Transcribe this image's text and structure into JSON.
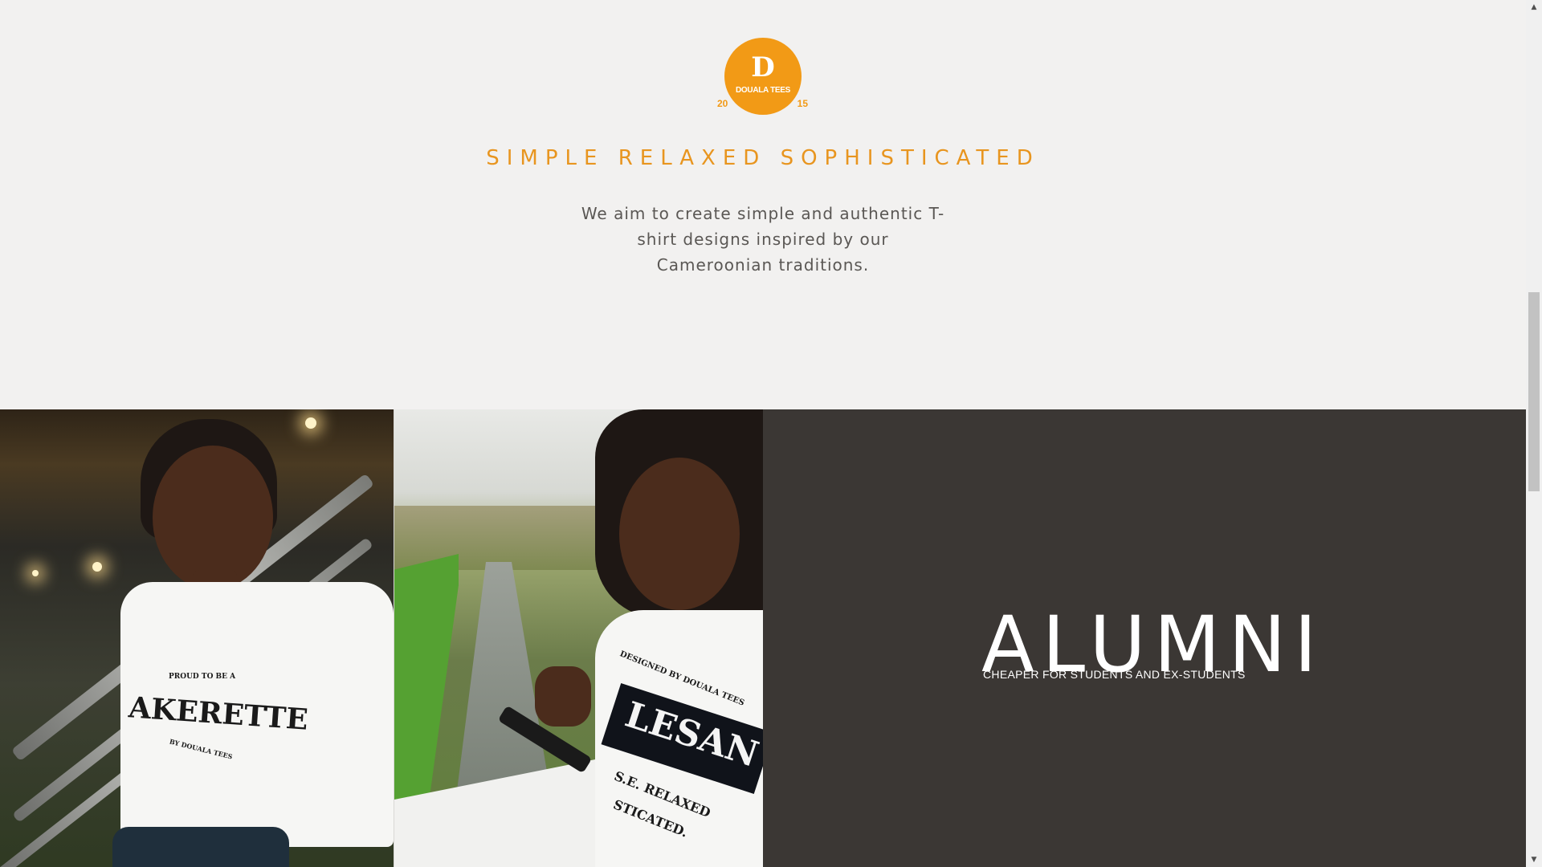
{
  "brand": {
    "logo_letter": "D",
    "logo_name": "DOUALA TEES",
    "year_left": "20",
    "year_right": "15",
    "accent_color": "#f29a16"
  },
  "hero": {
    "tagline": "SIMPLE RELAXED SOPHISTICATED",
    "intro": "We aim to create simple and authentic T-shirt designs inspired by our Cameroonian traditions."
  },
  "photos": {
    "photo_1_print_top": "PROUD TO BE A",
    "photo_1_print_main": "AKERETTE",
    "photo_1_print_bottom": "BY DOUALA TEES",
    "photo_2_print_top": "DESIGNED BY DOUALA TEES",
    "photo_2_print_main": "LESAN",
    "photo_2_print_bottom": "S.E. RELAXED",
    "photo_2_print_bottom2": "STICATED."
  },
  "alumni": {
    "title": "ALUMNI",
    "subtitle": "CHEAPER FOR STUDENTS AND EX-STUDENTS",
    "panel_color": "#3b3734"
  },
  "scrollbar": {
    "up_icon": "triangle-up",
    "down_icon": "triangle-down"
  }
}
